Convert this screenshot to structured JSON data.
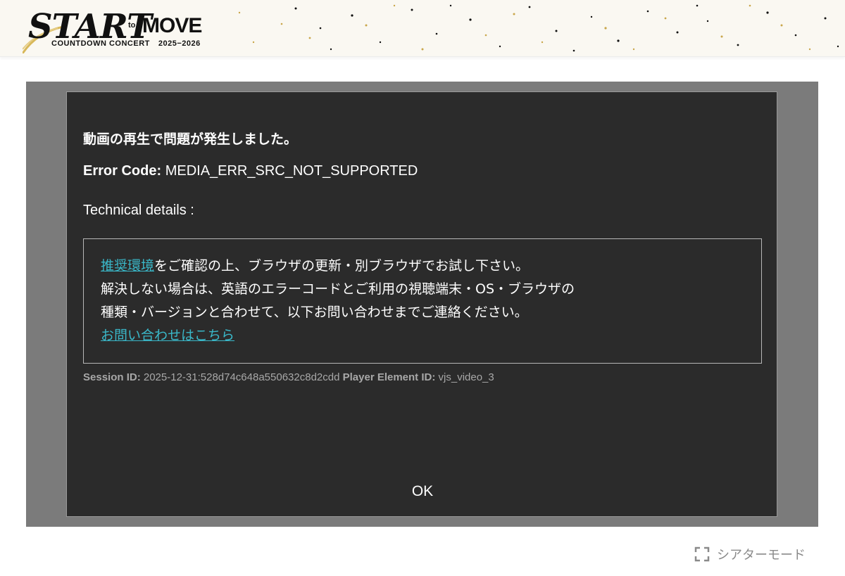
{
  "header": {
    "logo": {
      "title_start": "START",
      "title_to": "to",
      "title_move": "MOVE",
      "subtitle": "COUNTDOWN CONCERT",
      "years": "2025−2026"
    }
  },
  "error_dialog": {
    "title": "動画の再生で問題が発生しました。",
    "error_code_label": "Error Code:",
    "error_code_value": "MEDIA_ERR_SRC_NOT_SUPPORTED",
    "technical_details": "Technical details :",
    "message": {
      "recommended_link": "推奨環境",
      "line1_rest": "をご確認の上、ブラウザの更新・別ブラウザでお試し下さい。",
      "line2": "解決しない場合は、英語のエラーコードとご利用の視聴端末・OS・ブラウザの",
      "line3": "種類・バージョンと合わせて、以下お問い合わせまでご連絡ください。",
      "contact_link": "お問い合わせはこちら"
    },
    "session_label": "Session ID:",
    "session_value": "2025-12-31:528d74c648a550632c8d2cdd",
    "player_element_label": "Player Element ID:",
    "player_element_value": "vjs_video_3",
    "ok_label": "OK"
  },
  "theater_mode": {
    "label": "シアターモード",
    "icon": "expand-icon"
  },
  "colors": {
    "dialog_bg": "#2b2b2b",
    "player_bg": "#7b7b7b",
    "link": "#3ab8c9",
    "muted_text": "#a8a8a8"
  }
}
